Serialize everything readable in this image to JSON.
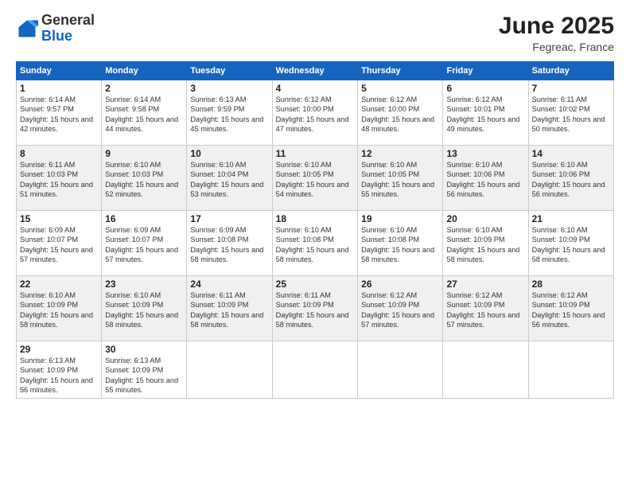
{
  "header": {
    "logo_general": "General",
    "logo_blue": "Blue",
    "month_year": "June 2025",
    "location": "Fegreac, France"
  },
  "weekdays": [
    "Sunday",
    "Monday",
    "Tuesday",
    "Wednesday",
    "Thursday",
    "Friday",
    "Saturday"
  ],
  "weeks": [
    [
      {
        "day": "1",
        "sunrise": "6:14 AM",
        "sunset": "9:57 PM",
        "daylight": "15 hours and 42 minutes."
      },
      {
        "day": "2",
        "sunrise": "6:14 AM",
        "sunset": "9:58 PM",
        "daylight": "15 hours and 44 minutes."
      },
      {
        "day": "3",
        "sunrise": "6:13 AM",
        "sunset": "9:59 PM",
        "daylight": "15 hours and 45 minutes."
      },
      {
        "day": "4",
        "sunrise": "6:12 AM",
        "sunset": "10:00 PM",
        "daylight": "15 hours and 47 minutes."
      },
      {
        "day": "5",
        "sunrise": "6:12 AM",
        "sunset": "10:00 PM",
        "daylight": "15 hours and 48 minutes."
      },
      {
        "day": "6",
        "sunrise": "6:12 AM",
        "sunset": "10:01 PM",
        "daylight": "15 hours and 49 minutes."
      },
      {
        "day": "7",
        "sunrise": "6:11 AM",
        "sunset": "10:02 PM",
        "daylight": "15 hours and 50 minutes."
      }
    ],
    [
      {
        "day": "8",
        "sunrise": "6:11 AM",
        "sunset": "10:03 PM",
        "daylight": "15 hours and 51 minutes."
      },
      {
        "day": "9",
        "sunrise": "6:10 AM",
        "sunset": "10:03 PM",
        "daylight": "15 hours and 52 minutes."
      },
      {
        "day": "10",
        "sunrise": "6:10 AM",
        "sunset": "10:04 PM",
        "daylight": "15 hours and 53 minutes."
      },
      {
        "day": "11",
        "sunrise": "6:10 AM",
        "sunset": "10:05 PM",
        "daylight": "15 hours and 54 minutes."
      },
      {
        "day": "12",
        "sunrise": "6:10 AM",
        "sunset": "10:05 PM",
        "daylight": "15 hours and 55 minutes."
      },
      {
        "day": "13",
        "sunrise": "6:10 AM",
        "sunset": "10:06 PM",
        "daylight": "15 hours and 56 minutes."
      },
      {
        "day": "14",
        "sunrise": "6:10 AM",
        "sunset": "10:06 PM",
        "daylight": "15 hours and 56 minutes."
      }
    ],
    [
      {
        "day": "15",
        "sunrise": "6:09 AM",
        "sunset": "10:07 PM",
        "daylight": "15 hours and 57 minutes."
      },
      {
        "day": "16",
        "sunrise": "6:09 AM",
        "sunset": "10:07 PM",
        "daylight": "15 hours and 57 minutes."
      },
      {
        "day": "17",
        "sunrise": "6:09 AM",
        "sunset": "10:08 PM",
        "daylight": "15 hours and 58 minutes."
      },
      {
        "day": "18",
        "sunrise": "6:10 AM",
        "sunset": "10:08 PM",
        "daylight": "15 hours and 58 minutes."
      },
      {
        "day": "19",
        "sunrise": "6:10 AM",
        "sunset": "10:08 PM",
        "daylight": "15 hours and 58 minutes."
      },
      {
        "day": "20",
        "sunrise": "6:10 AM",
        "sunset": "10:09 PM",
        "daylight": "15 hours and 58 minutes."
      },
      {
        "day": "21",
        "sunrise": "6:10 AM",
        "sunset": "10:09 PM",
        "daylight": "15 hours and 58 minutes."
      }
    ],
    [
      {
        "day": "22",
        "sunrise": "6:10 AM",
        "sunset": "10:09 PM",
        "daylight": "15 hours and 58 minutes."
      },
      {
        "day": "23",
        "sunrise": "6:10 AM",
        "sunset": "10:09 PM",
        "daylight": "15 hours and 58 minutes."
      },
      {
        "day": "24",
        "sunrise": "6:11 AM",
        "sunset": "10:09 PM",
        "daylight": "15 hours and 58 minutes."
      },
      {
        "day": "25",
        "sunrise": "6:11 AM",
        "sunset": "10:09 PM",
        "daylight": "15 hours and 58 minutes."
      },
      {
        "day": "26",
        "sunrise": "6:12 AM",
        "sunset": "10:09 PM",
        "daylight": "15 hours and 57 minutes."
      },
      {
        "day": "27",
        "sunrise": "6:12 AM",
        "sunset": "10:09 PM",
        "daylight": "15 hours and 57 minutes."
      },
      {
        "day": "28",
        "sunrise": "6:12 AM",
        "sunset": "10:09 PM",
        "daylight": "15 hours and 56 minutes."
      }
    ],
    [
      {
        "day": "29",
        "sunrise": "6:13 AM",
        "sunset": "10:09 PM",
        "daylight": "15 hours and 56 minutes."
      },
      {
        "day": "30",
        "sunrise": "6:13 AM",
        "sunset": "10:09 PM",
        "daylight": "15 hours and 55 minutes."
      },
      null,
      null,
      null,
      null,
      null
    ]
  ]
}
